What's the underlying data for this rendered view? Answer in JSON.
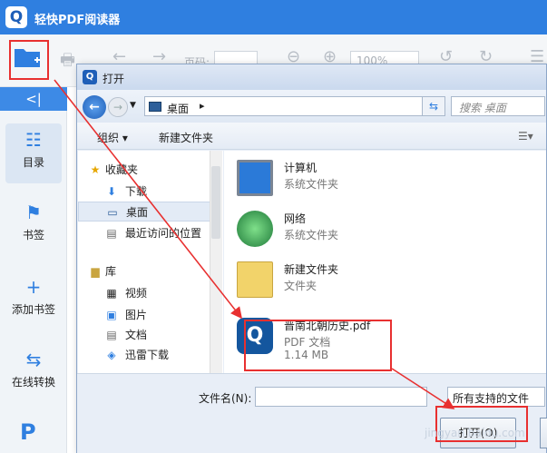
{
  "app": {
    "title": "轻快PDF阅读器",
    "logo_letter": "Q"
  },
  "toolbar": {
    "page_label": "页码:",
    "zoom_value": "100%"
  },
  "sidebar": {
    "collapse_glyph": "<|",
    "items": [
      {
        "label": "目录",
        "icon": "list-icon"
      },
      {
        "label": "书签",
        "icon": "bookmark-icon"
      },
      {
        "label": "添加书签",
        "icon": "plus-icon"
      },
      {
        "label": "在线转换",
        "icon": "convert-icon"
      }
    ]
  },
  "dialog": {
    "title": "打开",
    "address": "桌面",
    "search_placeholder": "搜索 桌面",
    "commands": {
      "organize": "组织 ▾",
      "new_folder": "新建文件夹"
    },
    "nav": [
      {
        "label": "收藏夹",
        "icon": "star-icon"
      },
      {
        "label": "下载",
        "icon": "download-folder-icon"
      },
      {
        "label": "桌面",
        "icon": "desktop-icon"
      },
      {
        "label": "最近访问的位置",
        "icon": "recent-places-icon"
      },
      {
        "label": "库",
        "icon": "library-icon"
      },
      {
        "label": "视频",
        "icon": "video-icon"
      },
      {
        "label": "图片",
        "icon": "image-icon"
      },
      {
        "label": "文档",
        "icon": "document-icon"
      },
      {
        "label": "迅雷下载",
        "icon": "thunder-download-icon"
      }
    ],
    "files": [
      {
        "name": "计算机",
        "type": "系统文件夹",
        "icon": "computer-icon"
      },
      {
        "name": "网络",
        "type": "系统文件夹",
        "icon": "network-icon"
      },
      {
        "name": "新建文件夹",
        "type": "文件夹",
        "icon": "folder-icon"
      },
      {
        "name": "晋南北朝历史.pdf",
        "type": "PDF 文档",
        "size": "1.14 MB",
        "icon": "pdf-icon"
      }
    ],
    "filename_label": "文件名(N):",
    "filename_value": "",
    "filter": "所有支持的文件",
    "open_button": "打开(O)"
  },
  "watermark": "jingyan.baidu.com",
  "colors": {
    "accent": "#2f7fe0",
    "highlight": "#e83030"
  }
}
